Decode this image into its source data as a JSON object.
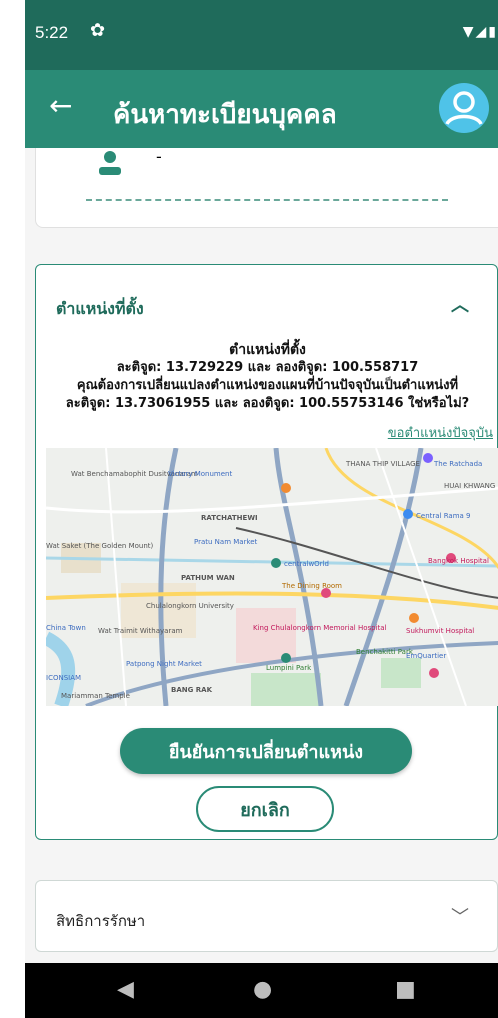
{
  "status_bar": {
    "time": "5:22"
  },
  "app_bar": {
    "title": "ค้นหาทะเบียนบุคคล"
  },
  "person_card": {
    "value": "-"
  },
  "location_section": {
    "header": "ตำแหน่งที่ตั้ง",
    "message": {
      "title": "ตำแหน่งที่ตั้ง",
      "line1": "ละติจูด: 13.729229 และ ลองติจูด: 100.558717",
      "line2": "คุณต้องการเปลี่ยนแปลงตำแหน่งของแผนที่บ้านปัจจุบันเป็นตำแหน่งที่",
      "line3": "ละติจูด: 13.73061955 และ ลองติจูด: 100.55753146 ใช่หรือไม่?"
    },
    "current_location_link": "ขอตำแหน่งปัจจุบัน",
    "map_labels": {
      "l1": "Wat Benchamabophit Dusitvanaram",
      "l2": "Victory Monument",
      "l3": "THANA THIP VILLAGE",
      "l4": "The Ratchada",
      "l5": "HUAI KHWANG",
      "l6": "RATCHATHEWI",
      "l7": "Central Rama 9",
      "l8": "Pratu Nam Market",
      "l9": "Wat Saket (The Golden Mount)",
      "l10": "PATHUM WAN",
      "l11": "centralwOrld",
      "l12": "Bangkok Hospital",
      "l13": "Chulalongkorn University",
      "l14": "The Dining Room",
      "l15": "China Town",
      "l16": "Wat Traimit Withayaram",
      "l17": "King Chulalongkorn Memorial Hospital",
      "l18": "Lumpini Park",
      "l19": "Benchakitti Park",
      "l20": "EmQuartier",
      "l21": "Patpong Night Market",
      "l22": "Mariamman Temple",
      "l23": "BANG RAK",
      "l24": "ICONSIAM",
      "l25": "Sukhumvit Hospital"
    },
    "confirm_button": "ยืนยันการเปลี่ยนตำแหน่ง",
    "cancel_button": "ยกเลิก"
  },
  "rights_section": {
    "label": "สิทธิการรักษา"
  },
  "colors": {
    "primary": "#2a8b76",
    "primary_dark": "#1f6b5b"
  },
  "icons": [
    "back-arrow-icon",
    "avatar-icon",
    "person-icon",
    "chevron-up-icon",
    "chevron-down-icon",
    "settings-gear-icon"
  ]
}
